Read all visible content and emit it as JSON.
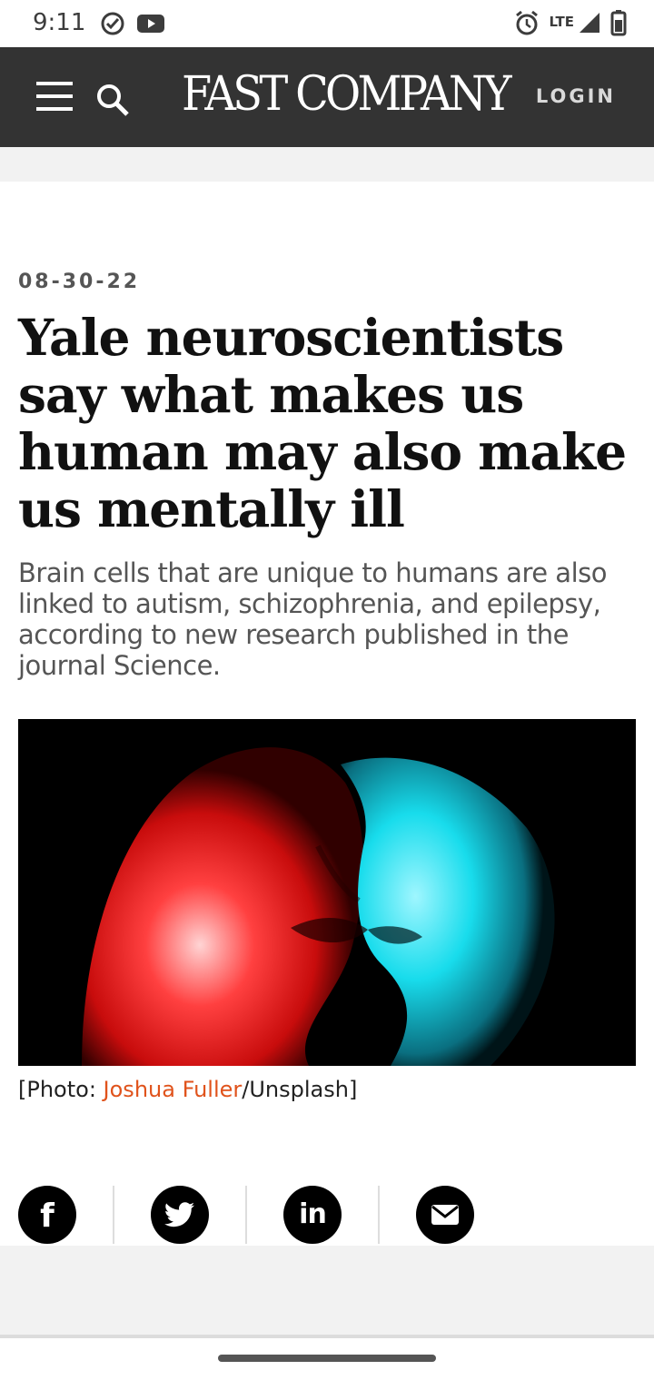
{
  "status_bar": {
    "time": "9:11",
    "network": "LTE",
    "icons": [
      "check-circle-icon",
      "youtube-icon",
      "alarm-icon",
      "signal-icon",
      "battery-icon"
    ]
  },
  "header": {
    "logo": "FAST COMPANY",
    "login_label": "LOGIN",
    "background": "#333333"
  },
  "article": {
    "date": "08-30-22",
    "title": "Yale neuroscientists say what makes us human may also make us mentally ill",
    "deck": "Brain cells that are unique to humans are also linked to autism, schizophrenia, and epilepsy, according to new research published in the journal Science.",
    "photo_credit_prefix": "[Photo: ",
    "photo_credit_author": "Joshua Fuller",
    "photo_credit_suffix": "/Unsplash]",
    "link_color": "#e0531c"
  },
  "share_buttons": [
    {
      "name": "facebook",
      "icon": "facebook-icon"
    },
    {
      "name": "twitter",
      "icon": "twitter-icon"
    },
    {
      "name": "linkedin",
      "icon": "linkedin-icon"
    },
    {
      "name": "email",
      "icon": "email-icon"
    }
  ]
}
